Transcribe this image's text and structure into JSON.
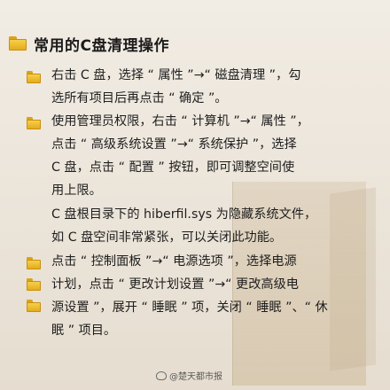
{
  "title": "常用的C盘清理操作",
  "items": [
    {
      "text": "右击 C 盘，选择 “ 属性 ”→“ 磁盘清理 ”，勾\n选所有项目后再点击 “ 确定 ”。"
    },
    {
      "text": "使用管理员权限，右击 “ 计算机 ”→“ 属性 ”，\n点击 “ 高级系统设置 ”→“ 系统保护 ”，选择\nC 盘，点击 “ 配置 ” 按钮，即可调整空间使\n用上限。"
    },
    {
      "text": "C 盘根目录下的 hiberfil.sys 为隐藏系统文件，\n如 C 盘空间非常紧张，可以关闭此功能。"
    },
    {
      "text": "点击 “ 控制面板 ”→“ 电源选项 ”，选择电源\n计划，点击 “ 更改计划设置 ”→“ 更改高级电\n源设置 ”，展开 “ 睡眠 ” 项，关闭 “ 睡眠 ”、“ 休\n眠 ” 项目。"
    }
  ],
  "watermark": "@楚天都市报",
  "colors": {
    "folder": "#e4ac1c",
    "background": "#ece5da"
  },
  "icons": [
    "folder-icon",
    "weibo-icon"
  ]
}
